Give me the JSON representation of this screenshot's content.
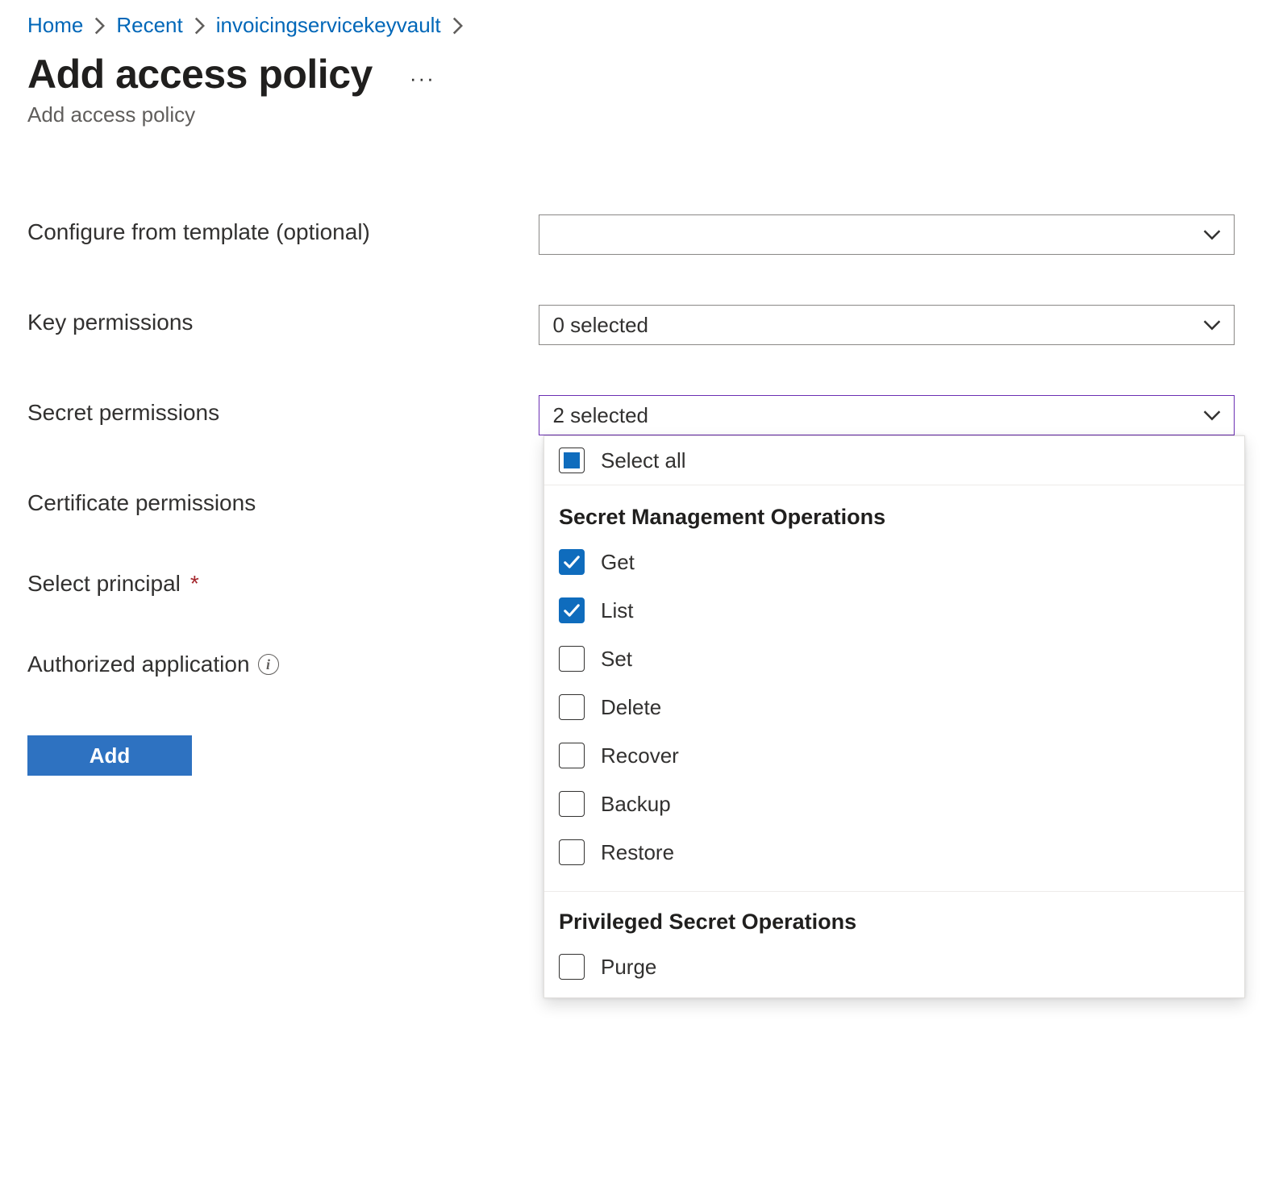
{
  "breadcrumb": {
    "items": [
      {
        "label": "Home"
      },
      {
        "label": "Recent"
      },
      {
        "label": "invoicingservicekeyvault"
      }
    ]
  },
  "header": {
    "title": "Add access policy",
    "subtitle": "Add access policy",
    "more": "···"
  },
  "form": {
    "templateLabel": "Configure from template (optional)",
    "templateValue": "",
    "keyPermissionsLabel": "Key permissions",
    "keyPermissionsValue": "0 selected",
    "secretPermissionsLabel": "Secret permissions",
    "secretPermissionsValue": "2 selected",
    "certificatePermissionsLabel": "Certificate permissions",
    "principalLabel": "Select principal",
    "authorizedLabel": "Authorized application",
    "addButton": "Add"
  },
  "secretDropdown": {
    "selectAll": "Select all",
    "group1": "Secret Management Operations",
    "options1": [
      {
        "label": "Get",
        "checked": true
      },
      {
        "label": "List",
        "checked": true
      },
      {
        "label": "Set",
        "checked": false
      },
      {
        "label": "Delete",
        "checked": false
      },
      {
        "label": "Recover",
        "checked": false
      },
      {
        "label": "Backup",
        "checked": false
      },
      {
        "label": "Restore",
        "checked": false
      }
    ],
    "group2": "Privileged Secret Operations",
    "options2": [
      {
        "label": "Purge",
        "checked": false
      }
    ]
  }
}
